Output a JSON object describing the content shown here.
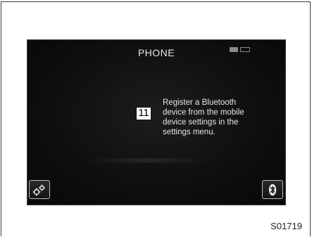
{
  "screen": {
    "title": "PHONE",
    "message_lines": [
      "Register a Bluetooth",
      "device from the mobile",
      "device settings in the",
      "settings menu."
    ]
  },
  "callout": {
    "number": "11"
  },
  "figure": {
    "code": "S01719"
  },
  "icons": {
    "settings": "gears-icon",
    "bluetooth": "bluetooth-icon"
  },
  "colors": {
    "screen_bg": "#0e0e0e",
    "text": "#e6e6e6",
    "button_border": "#bdbdbd"
  }
}
